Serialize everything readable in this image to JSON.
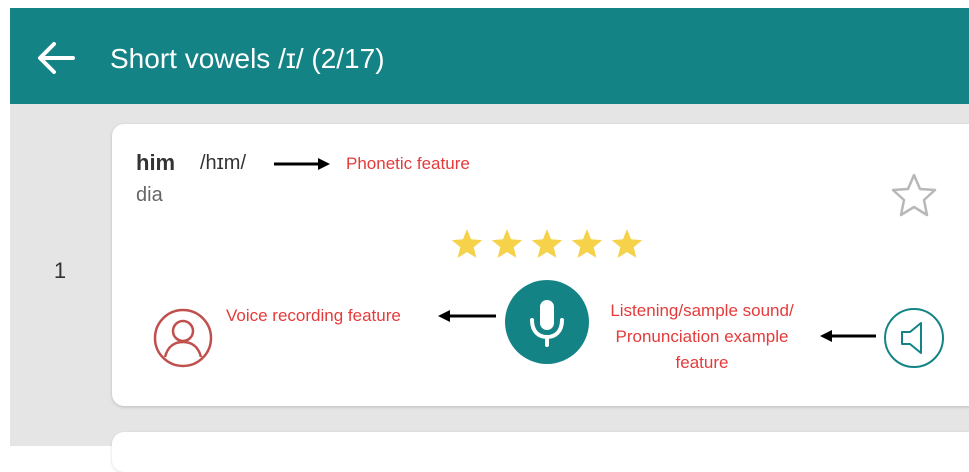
{
  "app_bar": {
    "title": "Short vowels /ɪ/ (2/17)",
    "color": "#138386"
  },
  "list": {
    "items": [
      {
        "index": "1",
        "word": "him",
        "phonetic": "/hɪm/",
        "meaning": "dia",
        "rating": 5,
        "rating_max": 5
      }
    ]
  },
  "annotations": {
    "phonetic": "Phonetic feature",
    "voice": "Voice recording feature",
    "listen_line1": "Listening/sample sound/",
    "listen_line2": "Pronunciation example",
    "listen_line3": "feature"
  },
  "icons": {
    "back": "arrow-left-icon",
    "favorite": "star-outline-icon",
    "rating_star": "star-filled-icon",
    "record_profile": "user-circle-icon",
    "microphone": "microphone-icon",
    "speaker": "speaker-icon"
  },
  "colors": {
    "accent": "#138386",
    "annotation": "#e53a3a",
    "rating_star": "#f5d24a",
    "user_icon": "#c0504d"
  }
}
